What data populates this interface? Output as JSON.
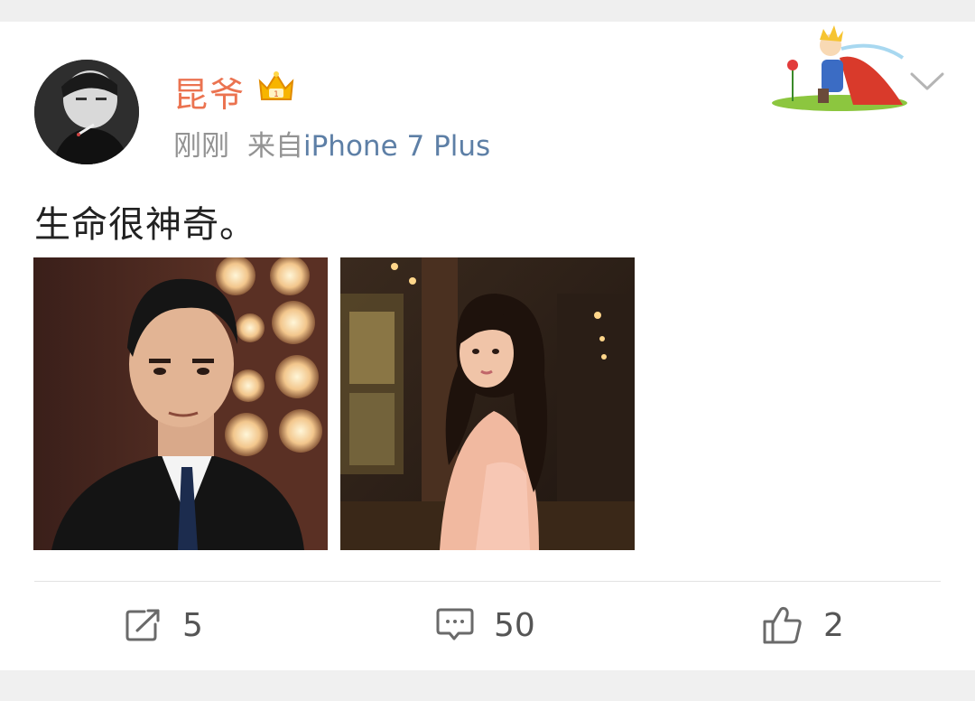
{
  "post": {
    "username": "昆爷",
    "time": "刚刚",
    "source_prefix": "来自",
    "source_device": "iPhone 7 Plus",
    "text": "生命很神奇。"
  },
  "icons": {
    "vip": "crown-vip-icon",
    "menu": "chevron-down-icon",
    "repost": "repost-icon",
    "comment": "comment-icon",
    "like": "thumbs-up-icon"
  },
  "colors": {
    "username": "#eb7350",
    "source_link": "#5d7fa6",
    "meta": "#939393",
    "text": "#222222",
    "badge": "#f5a623"
  },
  "actions": {
    "repost_count": "5",
    "comment_count": "50",
    "like_count": "2"
  }
}
